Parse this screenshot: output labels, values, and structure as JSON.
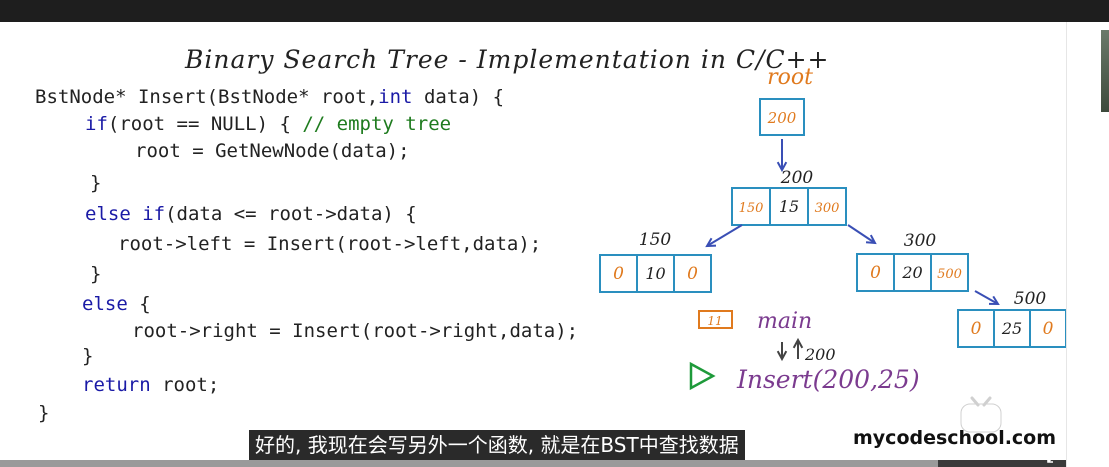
{
  "title": "Binary Search Tree - Implementation in C/C++",
  "code_lines": [
    [
      {
        "t": "BstNode* Insert(BstNode* root,"
      },
      {
        "t": "int",
        "c": "kw"
      },
      {
        "t": " data) {"
      }
    ],
    [
      {
        "t": "if",
        "c": "kw"
      },
      {
        "t": "(root == NULL) { "
      },
      {
        "t": "// empty tree",
        "c": "cm"
      }
    ],
    [
      {
        "t": "root = GetNewNode(data);"
      }
    ],
    [
      {
        "t": "}"
      }
    ],
    [
      {
        "t": "else if",
        "c": "kw"
      },
      {
        "t": "(data <= root->data) {"
      }
    ],
    [
      {
        "t": "root->left = Insert(root->left,data);"
      }
    ],
    [
      {
        "t": "}"
      }
    ],
    [
      {
        "t": "else",
        "c": "kw"
      },
      {
        "t": " {"
      }
    ],
    [
      {
        "t": "root->right = Insert(root->right,data);"
      }
    ],
    [
      {
        "t": "}"
      }
    ],
    [
      {
        "t": "return",
        "c": "kw"
      },
      {
        "t": " root;"
      }
    ],
    [
      {
        "t": "}"
      }
    ]
  ],
  "diagram": {
    "root_label": "root",
    "root_value": "200",
    "nodes": [
      {
        "addr": "200",
        "left": "150",
        "data": "15",
        "right": "300"
      },
      {
        "addr": "150",
        "left": "0",
        "data": "10",
        "right": "0"
      },
      {
        "addr": "300",
        "left": "0",
        "data": "20",
        "right": "500"
      },
      {
        "addr": "500",
        "left": "0",
        "data": "25",
        "right": "0"
      }
    ],
    "stack_frame_box": "11",
    "main_label": "main",
    "return_arrow_value": "200",
    "call_label": "Insert(200,25)"
  },
  "subtitle": "好的, 我现在会写另外一个函数, 就是在BST中查找数据",
  "watermark": "mycodeschool.com",
  "video_progress": 0.88,
  "colors": {
    "box_stroke": "#2a8fbf",
    "handwriting_orange": "#e07a1e",
    "handwriting_purple": "#7b3b8f",
    "arrow_blue": "#3a4fb5",
    "play_green": "#1e9a3a",
    "keyword_blue": "#1a1aa6",
    "comment_green": "#1e7b1e"
  }
}
